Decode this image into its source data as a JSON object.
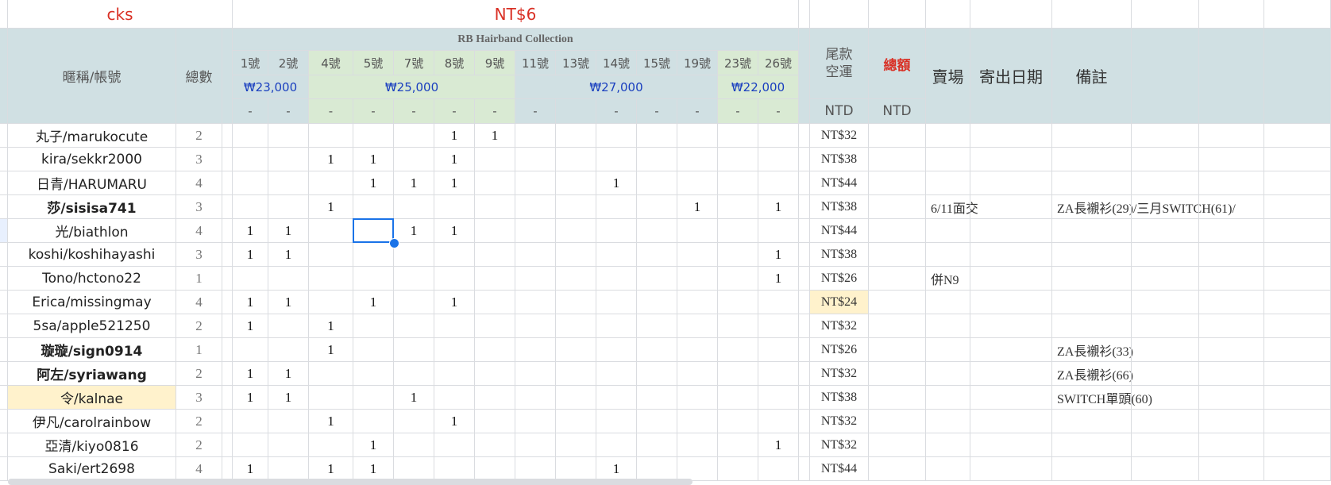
{
  "title_row": {
    "left": "cks",
    "center": "NT$6"
  },
  "collection_title": "RB Hairband Collection",
  "headers": {
    "name": "暱稱/帳號",
    "total": "總數",
    "balance": "尾款 空運",
    "sum": "總額",
    "venue": "賣場",
    "ship_date": "寄出日期",
    "note": "備註",
    "ntd1": "NTD",
    "ntd2": "NTD"
  },
  "item_columns": [
    "1號",
    "2號",
    "4號",
    "5號",
    "7號",
    "8號",
    "9號",
    "11號",
    "13號",
    "14號",
    "15號",
    "19號",
    "23號",
    "26號"
  ],
  "price_groups": [
    {
      "label": "₩23,000",
      "span": 2,
      "color": "#d0e0e3"
    },
    {
      "label": "₩25,000",
      "span": 5,
      "color": "#d9ead3"
    },
    {
      "label": "₩27,000",
      "span": 5,
      "color": "#d0e0e3"
    },
    {
      "label": "₩22,000",
      "span": 2,
      "color": "#d9ead3"
    }
  ],
  "dash": "-",
  "rows": [
    {
      "name": "丸子/marukocute",
      "bold": false,
      "highlight": false,
      "total": "2",
      "items": {
        "8號": "1",
        "9號": "1"
      },
      "balance": "NT$32",
      "balance_highlight": false,
      "venue": "",
      "note": ""
    },
    {
      "name": "kira/sekkr2000",
      "bold": false,
      "highlight": false,
      "total": "3",
      "items": {
        "4號": "1",
        "5號": "1",
        "8號": "1"
      },
      "balance": "NT$38",
      "balance_highlight": false,
      "venue": "",
      "note": ""
    },
    {
      "name": "日青/HARUMARU",
      "bold": false,
      "highlight": false,
      "total": "4",
      "items": {
        "5號": "1",
        "7號": "1",
        "8號": "1",
        "14號": "1"
      },
      "balance": "NT$44",
      "balance_highlight": false,
      "venue": "",
      "note": ""
    },
    {
      "name": "莎/sisisa741",
      "bold": true,
      "highlight": false,
      "total": "3",
      "items": {
        "4號": "1",
        "19號": "1",
        "26號": "1"
      },
      "balance": "NT$38",
      "balance_highlight": false,
      "venue": "6/11面交",
      "note": "ZA長襯衫(29)/三月SWITCH(61)/"
    },
    {
      "name": "光/biathlon",
      "bold": false,
      "highlight": false,
      "total": "4",
      "items": {
        "1號": "1",
        "2號": "1",
        "7號": "1",
        "8號": "1"
      },
      "balance": "NT$44",
      "balance_highlight": false,
      "venue": "",
      "note": ""
    },
    {
      "name": "koshi/koshihayashi",
      "bold": false,
      "highlight": false,
      "total": "3",
      "items": {
        "1號": "1",
        "2號": "1",
        "26號": "1"
      },
      "balance": "NT$38",
      "balance_highlight": false,
      "venue": "",
      "note": ""
    },
    {
      "name": "Tono/hctono22",
      "bold": false,
      "highlight": false,
      "total": "1",
      "items": {
        "26號": "1"
      },
      "balance": "NT$26",
      "balance_highlight": false,
      "venue": "併N9",
      "note": ""
    },
    {
      "name": "Erica/missingmay",
      "bold": false,
      "highlight": false,
      "total": "4",
      "items": {
        "1號": "1",
        "2號": "1",
        "5號": "1",
        "8號": "1"
      },
      "balance": "NT$24",
      "balance_highlight": true,
      "venue": "",
      "note": ""
    },
    {
      "name": "5sa/apple521250",
      "bold": false,
      "highlight": false,
      "total": "2",
      "items": {
        "1號": "1",
        "4號": "1"
      },
      "balance": "NT$32",
      "balance_highlight": false,
      "venue": "",
      "note": ""
    },
    {
      "name": "璇璇/sign0914",
      "bold": true,
      "highlight": false,
      "total": "1",
      "items": {
        "4號": "1"
      },
      "balance": "NT$26",
      "balance_highlight": false,
      "venue": "",
      "note": "ZA長襯衫(33)"
    },
    {
      "name": "阿左/syriawang",
      "bold": true,
      "highlight": false,
      "total": "2",
      "items": {
        "1號": "1",
        "2號": "1"
      },
      "balance": "NT$32",
      "balance_highlight": false,
      "venue": "",
      "note": "ZA長襯衫(66)"
    },
    {
      "name": "令/kalnae",
      "bold": false,
      "highlight": true,
      "total": "3",
      "items": {
        "1號": "1",
        "2號": "1",
        "7號": "1"
      },
      "balance": "NT$38",
      "balance_highlight": false,
      "venue": "",
      "note": "SWITCH單頭(60)"
    },
    {
      "name": "伊凡/carolrainbow",
      "bold": false,
      "highlight": false,
      "total": "2",
      "items": {
        "4號": "1",
        "8號": "1"
      },
      "balance": "NT$32",
      "balance_highlight": false,
      "venue": "",
      "note": ""
    },
    {
      "name": "亞清/kiyo0816",
      "bold": false,
      "highlight": false,
      "total": "2",
      "items": {
        "5號": "1",
        "26號": "1"
      },
      "balance": "NT$32",
      "balance_highlight": false,
      "venue": "",
      "note": ""
    },
    {
      "name": "Saki/ert2698",
      "bold": false,
      "highlight": false,
      "total": "4",
      "items": {
        "1號": "1",
        "4號": "1",
        "5號": "1",
        "14號": "1"
      },
      "balance": "NT$44",
      "balance_highlight": false,
      "venue": "",
      "note": ""
    }
  ],
  "selected_cell": {
    "row": 4,
    "column": "5號"
  },
  "colors": {
    "header_blue": "#d0e0e3",
    "header_green": "#d9ead3",
    "highlight_yellow": "#fff2cc",
    "selection": "#1a73e8",
    "title_red": "#d93025",
    "price_blue": "#1a3fbf"
  }
}
